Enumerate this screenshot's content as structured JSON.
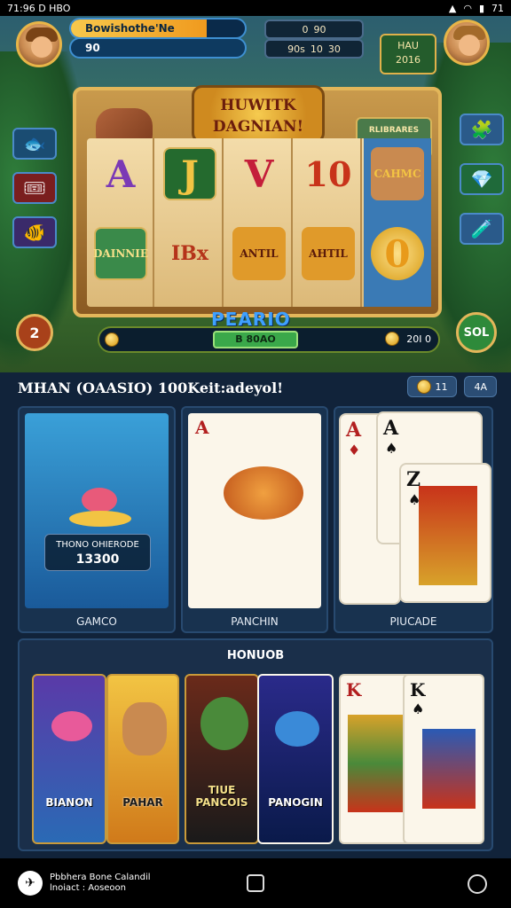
{
  "status_bar": {
    "time": "71:96 D HBO",
    "battery": "71"
  },
  "hud": {
    "player_name": "Bowishothe'Ne",
    "xp_progress": 0.78,
    "coins_label": "90",
    "box1": [
      "0",
      "90"
    ],
    "box2": [
      "90s",
      "10",
      "30"
    ],
    "right_panel": [
      "HAU",
      "2016"
    ]
  },
  "slot": {
    "title_line1": "HUWITK",
    "title_line2": "DAGNIAN!",
    "paytable": "RLIBRARES\nHARADARE",
    "symbols": [
      "A",
      "J",
      "V",
      "10",
      "0"
    ],
    "badges": [
      "DAINNIE",
      "IBx",
      "ANTIL",
      "AHTIL"
    ],
    "side_label": "CAHMC",
    "brand": "PEARIO",
    "level": "2",
    "spin": "SOL",
    "bet_center": "B 80AO",
    "bet_right": "20I 0",
    "colors": {
      "accent": "#e3b65a",
      "reel": "#f3dcaa",
      "bet": "#3aa84a"
    }
  },
  "lobby": {
    "header": "MHAN (OAASIO) 100Keit:adeyol!",
    "chip1": "11",
    "chip2": "4A",
    "games": [
      {
        "label": "GAMCO",
        "plate_title": "THONO OHIERODE",
        "plate_value": "13300"
      },
      {
        "label": "PANCHIN"
      },
      {
        "label": "PIUCADE"
      }
    ],
    "section2_title": "HONUOB",
    "mini_games": [
      "BIANON",
      "PAHAR",
      "TIUE PANCOIS",
      "PANOGIN",
      "",
      ""
    ]
  },
  "navbar": {
    "app_line1": "Pbbhera Bone Calandil",
    "app_line2": "lnoiact : Aoseoon"
  }
}
